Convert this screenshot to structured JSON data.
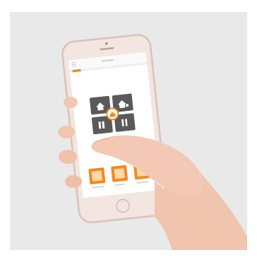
{
  "scene": {
    "description_tag": "hand-holding-smartphone-photo"
  },
  "phone": {
    "screen": {
      "status_text": "",
      "header_title": "",
      "tiles": [
        {
          "icon": "home-icon"
        },
        {
          "icon": "home-user-icon"
        },
        {
          "icon": "door-icon"
        },
        {
          "icon": "pause-icon"
        }
      ],
      "center_icon": "lock-house-icon",
      "bottom_tiles": [
        {
          "icon": "window-icon",
          "label": ""
        },
        {
          "icon": "shutter-icon",
          "label": ""
        },
        {
          "icon": "list-icon",
          "label": ""
        }
      ]
    }
  },
  "colors": {
    "background": "#e9e9e9",
    "phone_body": "#e8d2c8",
    "accent_orange": "#f28a1e",
    "tile_dark": "#5a5a5a",
    "skin": "#f1c7b4"
  }
}
